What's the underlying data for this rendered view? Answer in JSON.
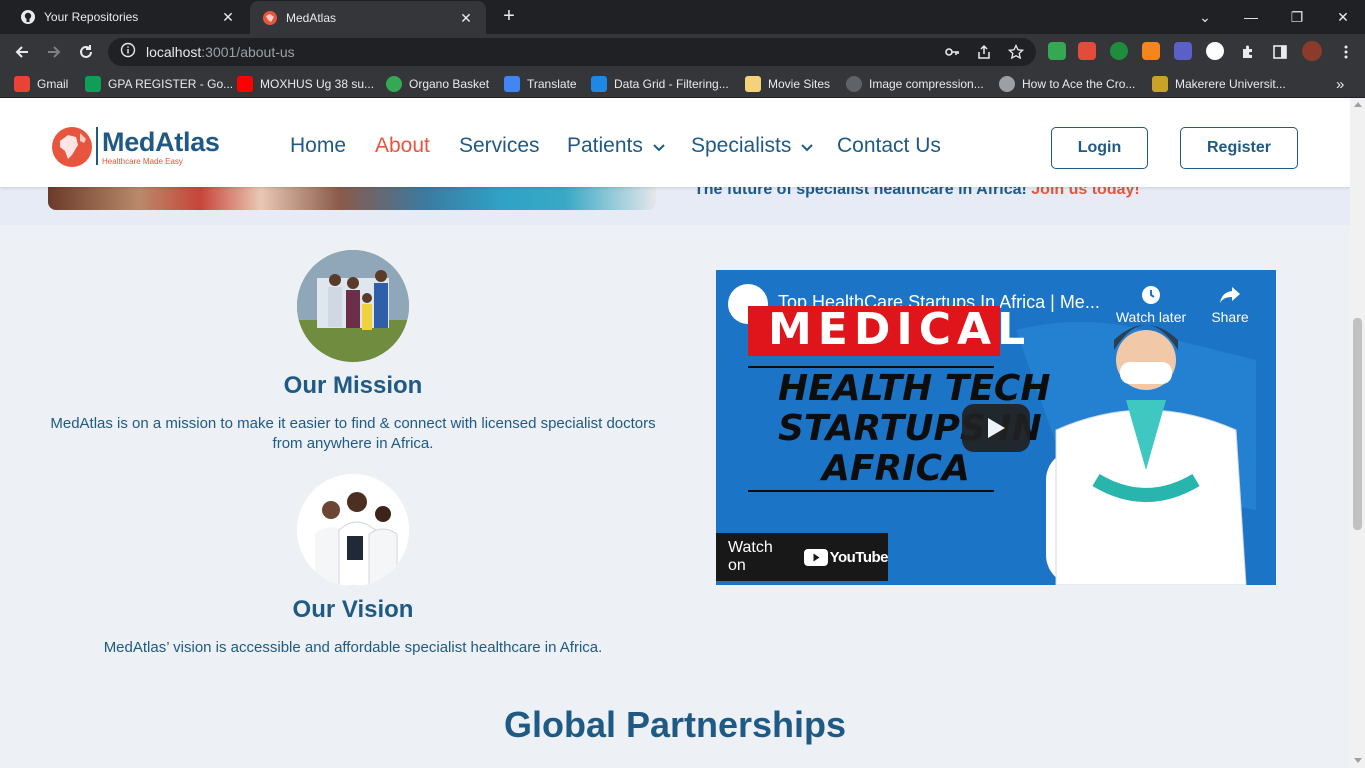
{
  "browser": {
    "tabs": [
      {
        "label": "Your Repositories",
        "icon": "github-icon",
        "active": false
      },
      {
        "label": "MedAtlas",
        "icon": "medatlas-favicon",
        "active": true
      }
    ],
    "url_host": "localhost",
    "url_path": ":3001/about-us",
    "bookmarks": [
      {
        "label": "Gmail",
        "icon": "gmail-icon",
        "color": "#ea4335"
      },
      {
        "label": "GPA REGISTER - Go...",
        "icon": "sheets-icon",
        "color": "#0f9d58"
      },
      {
        "label": "MOXHUS Ug 38 su...",
        "icon": "youtube-icon",
        "color": "#ff0000"
      },
      {
        "label": "Organo Basket",
        "icon": "organo-icon",
        "color": "#34a853"
      },
      {
        "label": "Translate",
        "icon": "translate-icon",
        "color": "#4285f4"
      },
      {
        "label": "Data Grid - Filtering...",
        "icon": "mui-icon",
        "color": "#1e88e5"
      },
      {
        "label": "Movie Sites",
        "icon": "folder-icon",
        "color": "#f4d27a"
      },
      {
        "label": "Image compression...",
        "icon": "github-icon",
        "color": "#5f6368"
      },
      {
        "label": "How to Ace the Cro...",
        "icon": "eye-icon",
        "color": "#9aa0a6"
      },
      {
        "label": "Makerere Universit...",
        "icon": "makerere-icon",
        "color": "#c9a227"
      }
    ],
    "more_bookmarks": "»"
  },
  "site": {
    "brand": "MedAtlas",
    "tagline": "Healthcare Made Easy",
    "nav": {
      "home": "Home",
      "about": "About",
      "services": "Services",
      "patients": "Patients",
      "specialists": "Specialists",
      "contact": "Contact Us"
    },
    "login": "Login",
    "register": "Register",
    "accent": "#e8553e",
    "primary": "#1f5a85"
  },
  "hero": {
    "text": "The future of specialist healthcare in Africa! ",
    "cta": "Join us today!"
  },
  "mission": {
    "title": "Our Mission",
    "text": "MedAtlas is on a mission to make it easier to find & connect with licensed specialist doctors from anywhere in Africa."
  },
  "vision": {
    "title": "Our Vision",
    "text": "MedAtlas’ vision is accessible and affordable specialist healthcare in Africa."
  },
  "video": {
    "title": "Top HealthCare Startups In Africa | Me...",
    "watch_later": "Watch later",
    "share": "Share",
    "banner": "MEDICAL",
    "line1": "HEALTH TECH",
    "line2": "STARTUPS IN",
    "line3": "AFRICA",
    "watch_on": "Watch on",
    "youtube": "YouTube"
  },
  "partnerships": {
    "title": "Global Partnerships"
  }
}
